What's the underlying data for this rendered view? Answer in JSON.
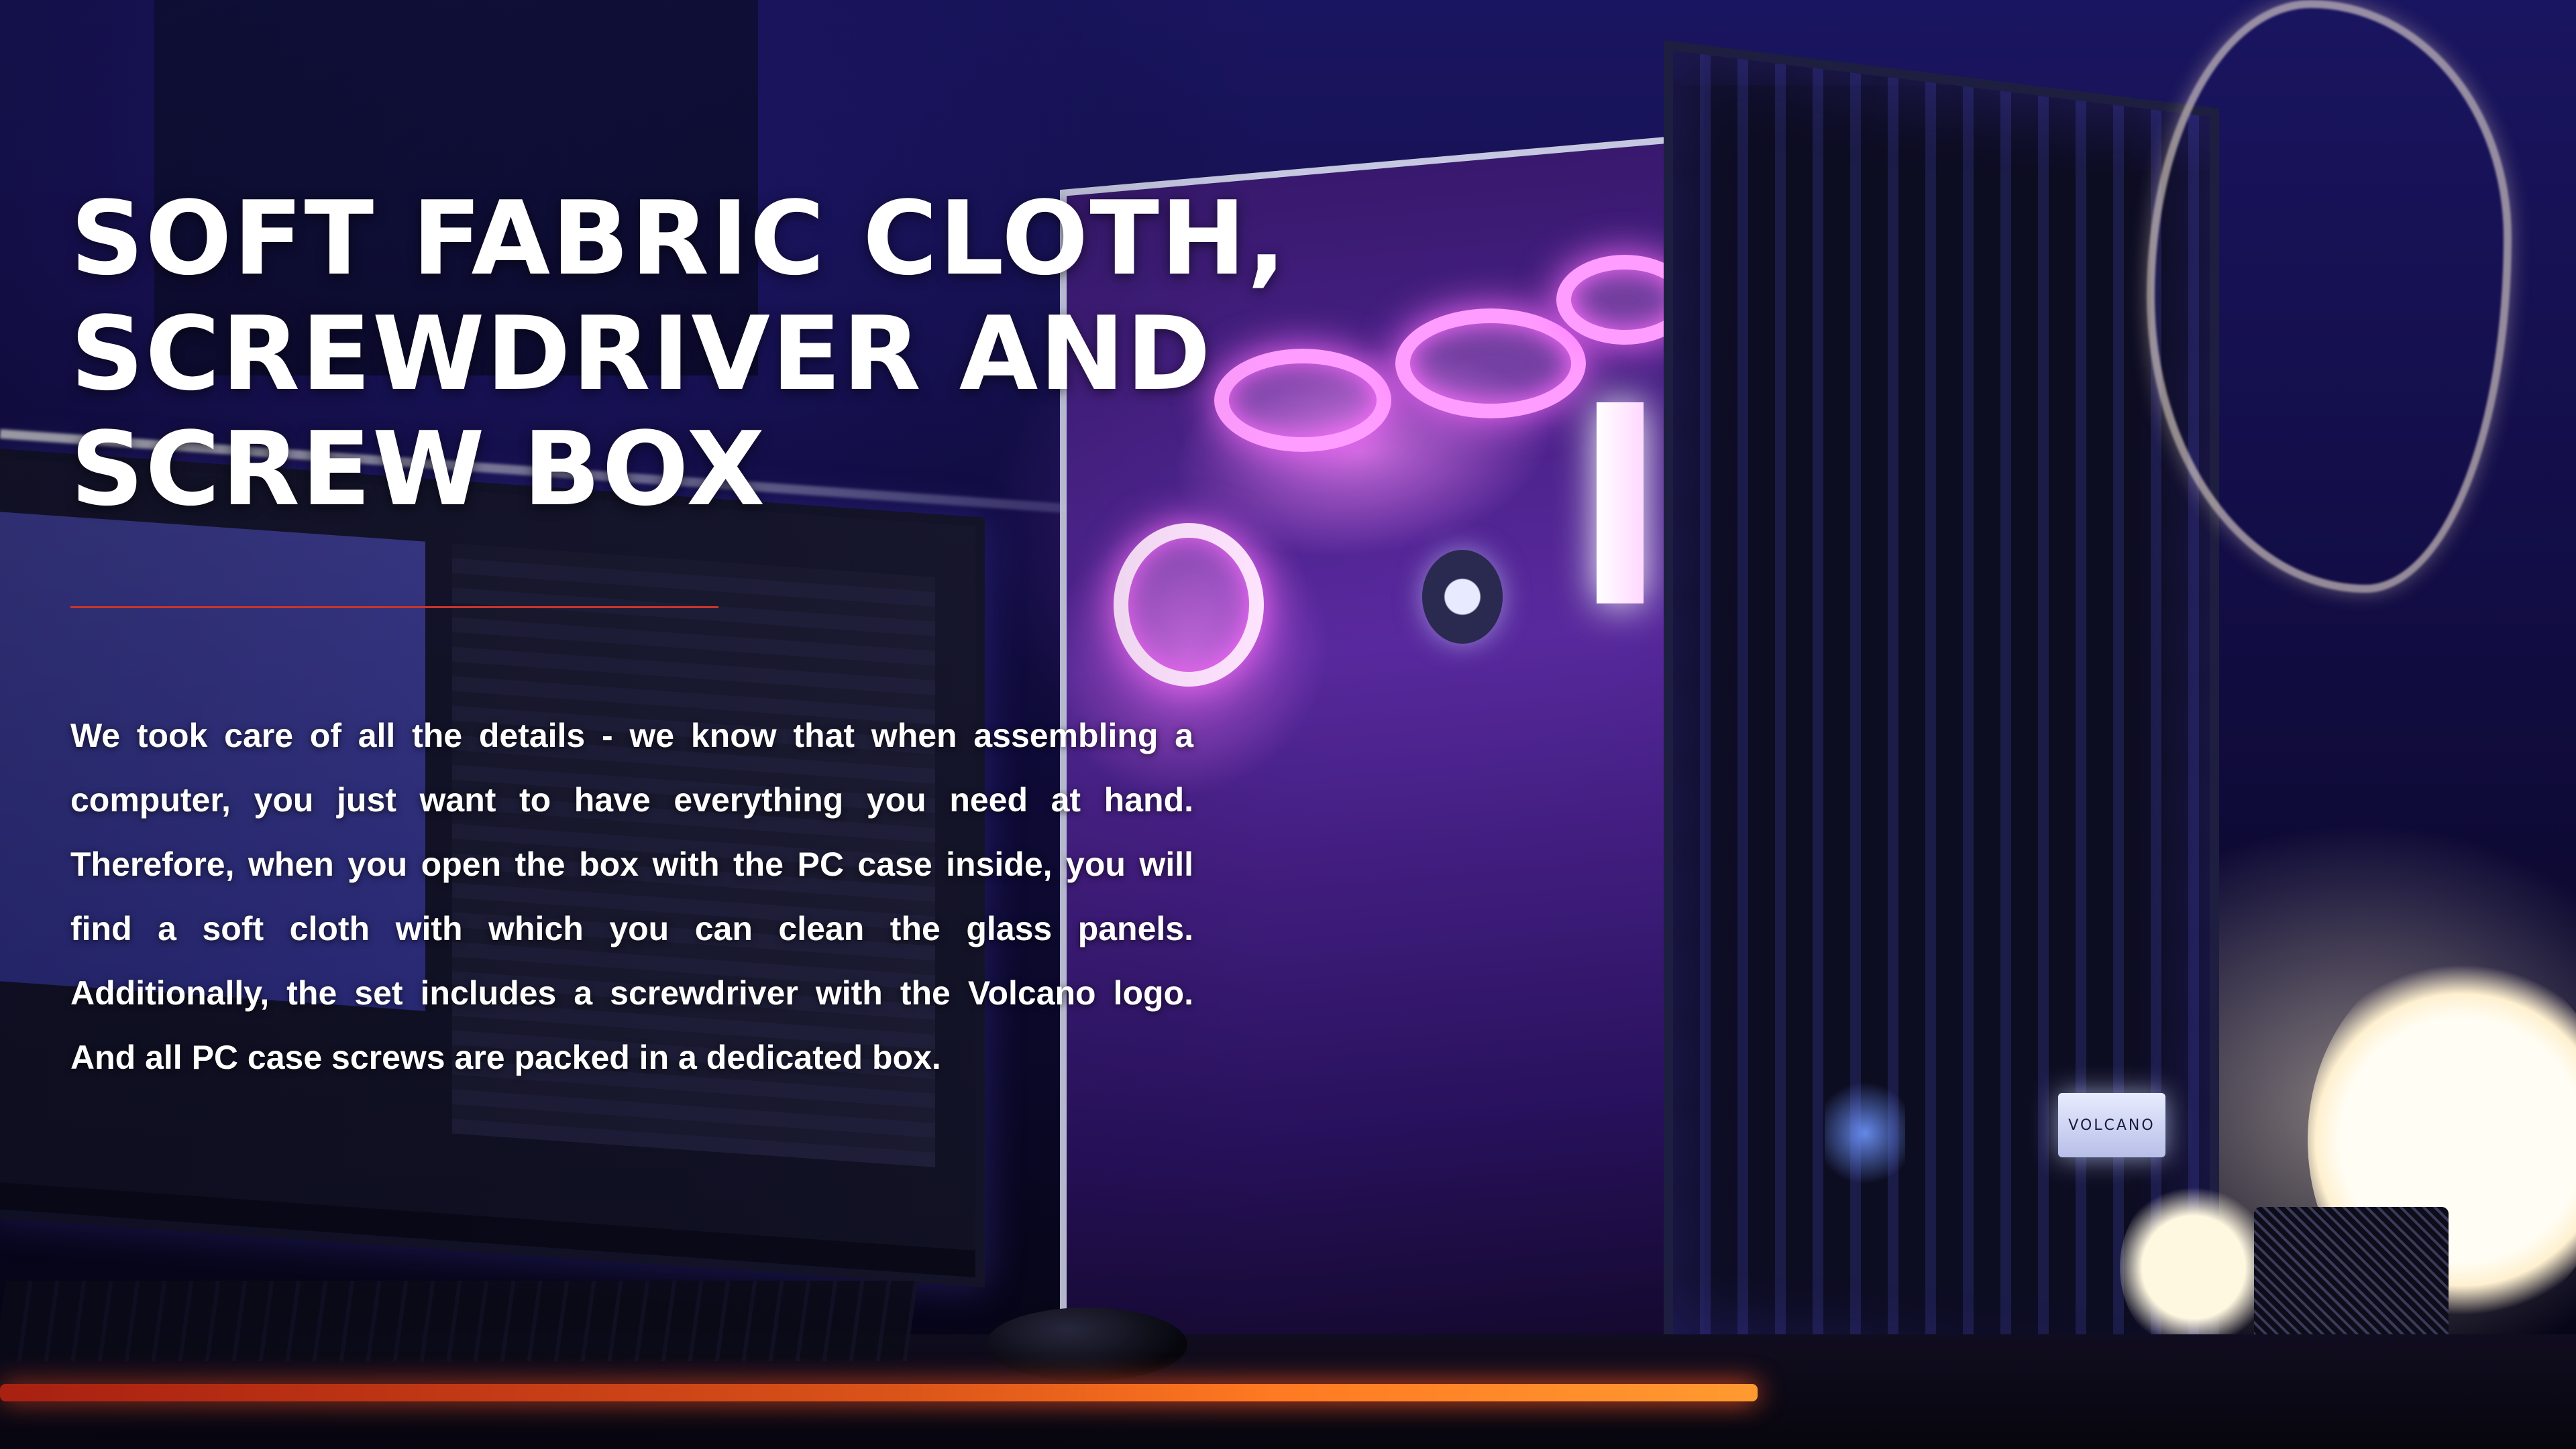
{
  "hero": {
    "headline_lines": [
      "SOFT FABRIC CLOTH,",
      "SCREWDRIVER AND",
      "SCREW BOX"
    ],
    "body": "We took care of all the details - we know that when assembling a computer, you just want to have everything you need at hand. Therefore, when you open the box with the PC case inside, you will find a soft cloth with which you can clean the glass panels. Additionally, the set includes a screwdriver with the Volcano logo. And all PC case screws are packed in a dedicated box."
  },
  "product": {
    "badge_label": "VOLCANO"
  },
  "colors": {
    "accent_divider": "#c8362a",
    "headline_text": "#ffffff",
    "body_text": "#ffffff",
    "desk_led": "#ff5520",
    "case_glow": "#ff6dff"
  }
}
